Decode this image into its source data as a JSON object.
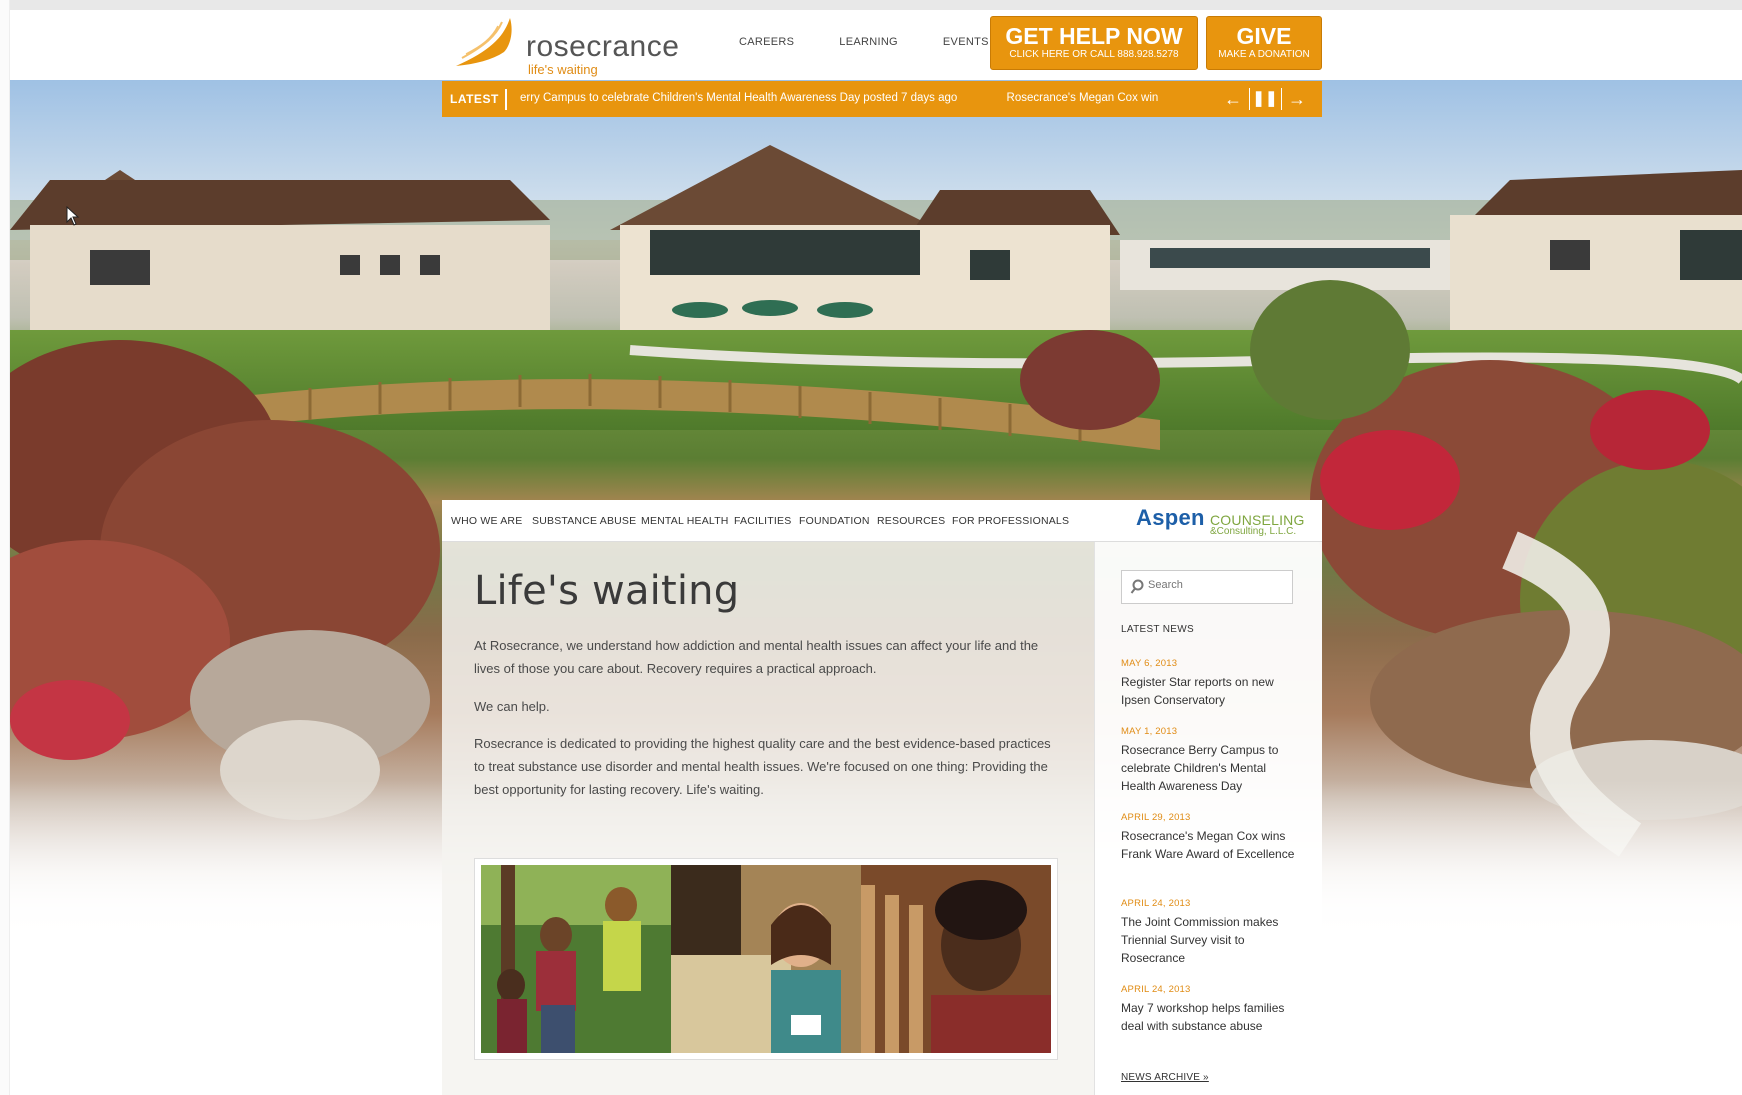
{
  "brand": {
    "name": "rosecrance",
    "tagline": "life's waiting"
  },
  "top_nav": [
    "CAREERS",
    "LEARNING",
    "EVENTS"
  ],
  "cta": {
    "help_title": "GET HELP NOW",
    "help_sub": "CLICK HERE OR CALL 888.928.5278",
    "give_title": "GIVE",
    "give_sub": "MAKE A DONATION"
  },
  "ticker": {
    "label": "LATEST",
    "items": [
      "erry Campus to celebrate Children's Mental Health Awareness Day posted 7 days ago",
      "Rosecrance's Megan Cox wins Frank Ware A"
    ]
  },
  "main_nav": [
    "WHO WE ARE",
    "SUBSTANCE ABUSE",
    "MENTAL HEALTH",
    "FACILITIES",
    "FOUNDATION",
    "RESOURCES",
    "FOR PROFESSIONALS"
  ],
  "partner": {
    "name_a": "Aspen",
    "name_b": "COUNSELING",
    "name_c": "&Consulting, L.L.C."
  },
  "content": {
    "title": "Life's waiting",
    "paragraphs": [
      "At Rosecrance, we understand how addiction and mental health issues can affect your life and the lives of those you care about. Recovery requires a practical approach.",
      "We can help.",
      "Rosecrance is dedicated to providing the highest quality care and the best evidence-based practices to treat substance use disorder and mental health issues. We're focused on one thing: Providing the best opportunity for lasting recovery. Life's waiting."
    ]
  },
  "sidebar": {
    "search_placeholder": "Search",
    "heading": "LATEST NEWS",
    "news": [
      {
        "date": "MAY 6, 2013",
        "title": "Register Star reports on new Ipsen Conservatory"
      },
      {
        "date": "MAY 1, 2013",
        "title": "Rosecrance Berry Campus to celebrate Children's Mental Health Awareness Day"
      },
      {
        "date": "APRIL 29, 2013",
        "title": "Rosecrance's Megan Cox wins Frank Ware Award of Excellence"
      },
      {
        "date": "APRIL 24, 2013",
        "title": "The Joint Commission makes Triennial Survey visit to Rosecrance"
      },
      {
        "date": "APRIL 24, 2013",
        "title": "May 7 workshop helps families deal with substance abuse"
      }
    ],
    "archive": "NEWS ARCHIVE »"
  },
  "colors": {
    "accent": "#e8950e",
    "date": "#e08c15",
    "partner_blue": "#1d5fa8",
    "partner_green": "#7fa640"
  },
  "icons": [
    "wing-logo-icon",
    "arrow-left-icon",
    "pause-icon",
    "arrow-right-icon",
    "search-icon",
    "cursor-icon"
  ]
}
